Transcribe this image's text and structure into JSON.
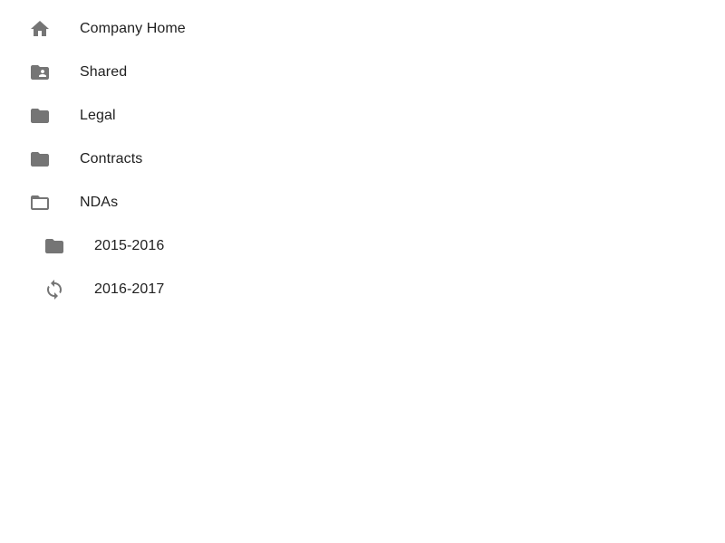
{
  "tree": {
    "items": [
      {
        "label": "Company Home",
        "icon": "home-icon"
      },
      {
        "label": "Shared",
        "icon": "shared-folder-icon"
      },
      {
        "label": "Legal",
        "icon": "folder-icon"
      },
      {
        "label": "Contracts",
        "icon": "folder-icon"
      },
      {
        "label": "NDAs",
        "icon": "folder-open-outline-icon"
      },
      {
        "label": "2015-2016",
        "icon": "folder-icon"
      },
      {
        "label": "2016-2017",
        "icon": "sync-icon"
      }
    ]
  },
  "colors": {
    "icon": "#757575",
    "text": "#212121",
    "background": "#ffffff"
  }
}
